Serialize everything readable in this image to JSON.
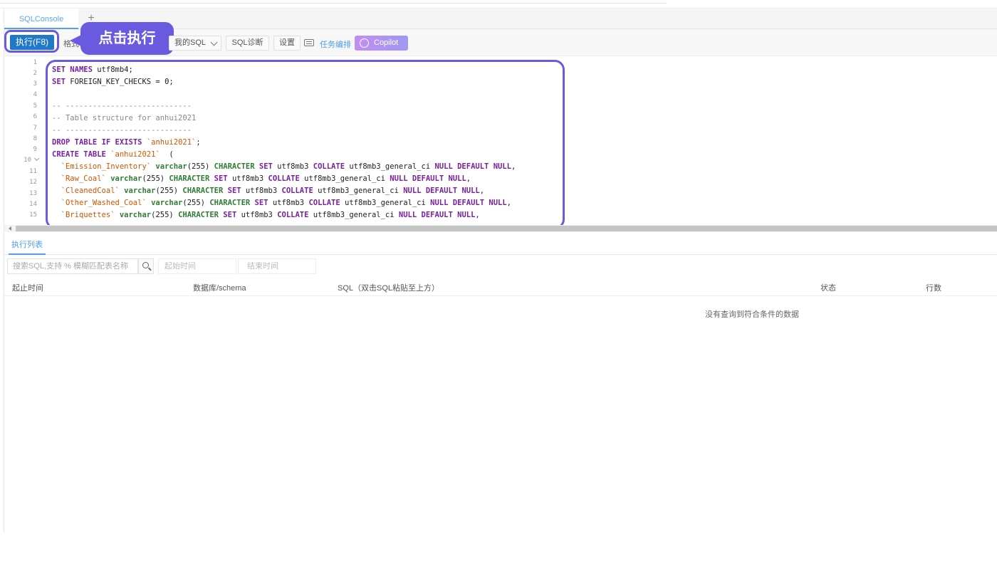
{
  "tabs": [
    {
      "label": "SQLConsole"
    }
  ],
  "tab_add_label": "+",
  "toolbar": {
    "run_label": "执行(F8)",
    "partial_label": "格式",
    "my_sql_label": "我的SQL",
    "diagnose_label": "SQL诊断",
    "settings_label": "设置",
    "task_label": "任务编排",
    "copilot_label": "Copilot"
  },
  "callout": {
    "text": "点击执行"
  },
  "editor": {
    "line_numbers": [
      "1",
      "2",
      "3",
      "4",
      "5",
      "6",
      "7",
      "8",
      "9",
      "10",
      "11",
      "12",
      "13",
      "14",
      "15"
    ],
    "code_lines": [
      "SET NAMES utf8mb4;",
      "SET FOREIGN_KEY_CHECKS = 0;",
      "",
      "-- ----------------------------",
      "-- Table structure for anhui2021",
      "-- ----------------------------",
      "DROP TABLE IF EXISTS `anhui2021`;",
      "CREATE TABLE `anhui2021`  (",
      "  `Emission_Inventory` varchar(255) CHARACTER SET utf8mb3 COLLATE utf8mb3_general_ci NULL DEFAULT NULL,",
      "  `Raw_Coal` varchar(255) CHARACTER SET utf8mb3 COLLATE utf8mb3_general_ci NULL DEFAULT NULL,",
      "  `CleanedCoal` varchar(255) CHARACTER SET utf8mb3 COLLATE utf8mb3_general_ci NULL DEFAULT NULL,",
      "  `Other_Washed_Coal` varchar(255) CHARACTER SET utf8mb3 COLLATE utf8mb3_general_ci NULL DEFAULT NULL,",
      "  `Briquettes` varchar(255) CHARACTER SET utf8mb3 COLLATE utf8mb3_general_ci NULL DEFAULT NULL,"
    ]
  },
  "results": {
    "tab_label": "执行列表",
    "search_placeholder": "搜索SQL,支持 % 模糊匹配表名称",
    "start_time_placeholder": "起始时间",
    "end_time_placeholder": "结束时间",
    "columns": [
      "起止时间",
      "数据库/schema",
      "SQL（双击SQL粘贴至上方）",
      "状态",
      "行数"
    ],
    "empty_text": "没有查询到符合条件的数据"
  },
  "colors": {
    "accent": "#6a5ae0",
    "run_button": "#1f78c8",
    "link": "#4d9ff0",
    "keyword": "#7b1fa2",
    "string": "#d35400",
    "type": "#2e7d32",
    "comment": "#888888"
  }
}
